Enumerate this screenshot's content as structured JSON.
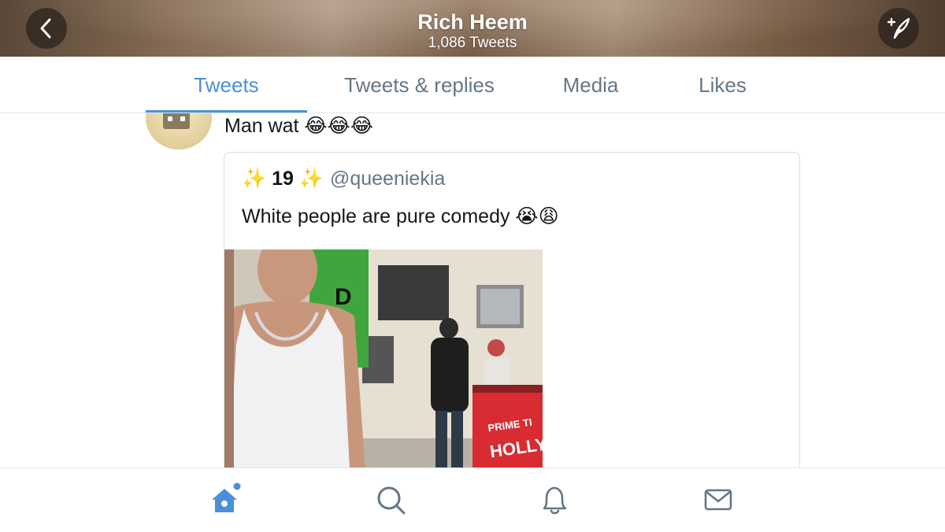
{
  "header": {
    "title": "Rich Heem",
    "subtitle": "1,086 Tweets",
    "back_icon": "chevron-left-icon",
    "compose_icon": "compose-tweet-icon"
  },
  "tabs": [
    {
      "label": "Tweets",
      "active": true
    },
    {
      "label": "Tweets & replies",
      "active": false
    },
    {
      "label": "Media",
      "active": false
    },
    {
      "label": "Likes",
      "active": false
    }
  ],
  "tweet": {
    "text": "Man wat 😂😂😂"
  },
  "quoted_tweet": {
    "name": "✨ 19 ✨",
    "handle": "@queeniekia",
    "text": "White people are pure comedy 😭😩",
    "media_sign_text": "PRIME TI HOLLY"
  },
  "bottom_nav": [
    {
      "icon": "home-icon",
      "active": true
    },
    {
      "icon": "search-icon",
      "active": false
    },
    {
      "icon": "notifications-bell-icon",
      "active": false
    },
    {
      "icon": "messages-mail-icon",
      "active": false
    }
  ],
  "colors": {
    "accent": "#4a90d9",
    "text": "#14171a",
    "secondary_text": "#657786"
  }
}
